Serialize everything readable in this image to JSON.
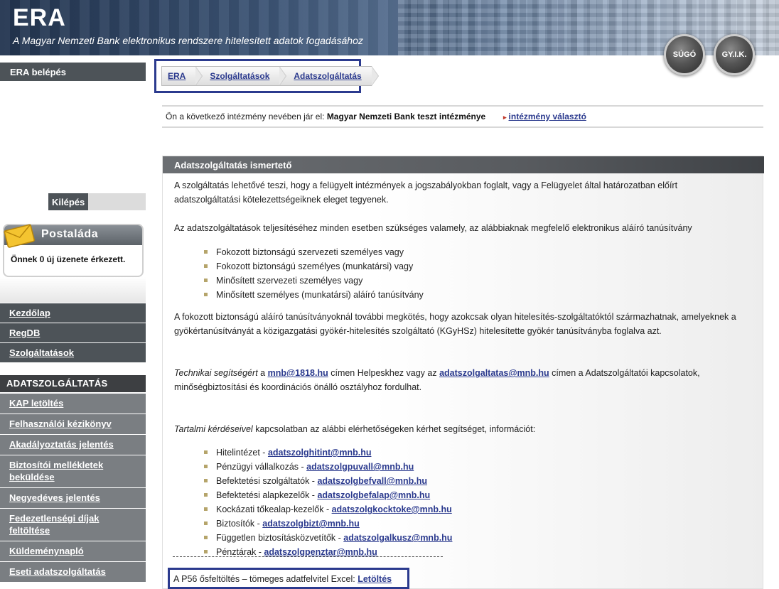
{
  "header": {
    "logo": "ERA",
    "tagline": "A Magyar Nemzeti Bank elektronikus rendszere hitelesített adatok fogadásához",
    "help_button": "SÚGÓ",
    "faq_button": "GY.I.K."
  },
  "sidebar": {
    "login_title": "ERA belépés",
    "logout": "Kilépés",
    "mailbox_title": "Postaláda",
    "mailbox_text": "Önnek 0 új üzenete érkezett.",
    "main_nav": [
      "Kezdőlap",
      "RegDB",
      "Szolgáltatások"
    ],
    "section_title": "ADATSZOLGÁLTATÁS",
    "section_items": [
      "KAP letöltés",
      "Felhasználói kézikönyv",
      "Akadályoztatás jelentés",
      "Biztosítói mellékletek beküldése",
      "Negyedéves jelentés",
      "Fedezetlenségi díjak feltöltése",
      "Küldeménynapló",
      "Eseti adatszolgáltatás"
    ]
  },
  "breadcrumb": [
    "ERA",
    "Szolgáltatások",
    "Adatszolgáltatás"
  ],
  "institution": {
    "prefix": "Ön a következő intézmény nevében jár el:",
    "name": "Magyar Nemzeti Bank teszt intézménye",
    "switch_link": "intézmény választó"
  },
  "panel": {
    "title": "Adatszolgáltatás  ismertető",
    "intro": "A szolgáltatás lehetővé teszi, hogy a felügyelt intézmények a jogszabályokban foglalt, vagy a Felügyelet által határozatban előírt adatszolgáltatási kötelezettségeiknek eleget tegyenek.",
    "cert_intro": "Az adatszolgáltatások teljesítéséhez minden esetben szükséges valamely, az alábbiaknak megfelelő elektronikus aláíró tanúsítvány",
    "cert_types": [
      "Fokozott biztonságú szervezeti személyes vagy",
      "Fokozott biztonságú személyes (munkatársi) vagy",
      "Minősített szervezeti személyes vagy",
      "Minősített személyes (munkatársi) aláíró tanúsítvány"
    ],
    "cert_note": "A fokozott biztonságú aláíró tanúsítványoknál további megkötés, hogy azokcsak olyan hitelesítés-szolgáltatóktól származhatnak, amelyeknek a gyökértanúsítványát a közigazgatási gyökér-hitelesítés szolgáltató (KGyHSz) hitelesítette gyökér tanúsítványba foglalva azt.",
    "tech_prefix": "Technikai segítségért",
    "tech_a": "a",
    "tech_email1": "mnb@1818.hu",
    "tech_mid": "címen Helpeskhez vagy az",
    "tech_email2": "adatszolgaltatas@mnb.hu",
    "tech_suffix": "címen a Adatszolgáltatói kapcsolatok, minőségbiztosítási és koordinációs önálló osztályhoz fordulhat.",
    "content_prefix": "Tartalmi kérdéseivel",
    "content_suffix": "kapcsolatban az alábbi elérhetőségeken kérhet segítséget, információt:",
    "contacts": [
      {
        "label": "Hitelintézet - ",
        "email": "adatszolghitint@mnb.hu"
      },
      {
        "label": "Pénzügyi vállalkozás - ",
        "email": "adatszolgpuvall@mnb.hu"
      },
      {
        "label": "Befektetési szolgáltatók - ",
        "email": "adatszolgbefvall@mnb.hu"
      },
      {
        "label": "Befektetési alapkezelők - ",
        "email": "adatszolgbefalap@mnb.hu"
      },
      {
        "label": "Kockázati tőkealap-kezelők - ",
        "email": "adatszolgkocktoke@mnb.hu"
      },
      {
        "label": "Biztosítók - ",
        "email": "adatszolgbizt@mnb.hu"
      },
      {
        "label": "Független biztosításközvetítők - ",
        "email": "adatszolgalkusz@mnb.hu"
      },
      {
        "label": "Pénztárak - ",
        "email": "adatszolgpenztar@mnb.hu"
      }
    ],
    "p56_text": "A P56 ősfeltöltés – tömeges adatfelvitel Excel:",
    "p56_link": "Letöltés"
  },
  "colors": {
    "accent": "#2b3a8e",
    "nav_dark": "#4d5358",
    "nav_light": "#7a7e82",
    "bullet": "#b5a46a"
  }
}
